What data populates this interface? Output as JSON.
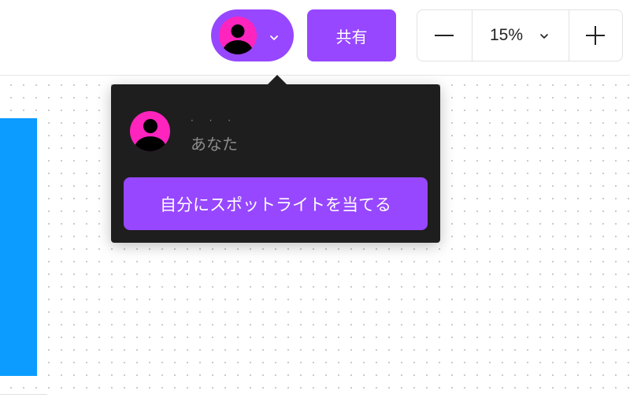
{
  "toolbar": {
    "share_label": "共有",
    "zoom_level": "15%"
  },
  "user_popover": {
    "user_name": "· · ·",
    "you_label": "あなた",
    "spotlight_label": "自分にスポットライトを当てる"
  },
  "icons": {
    "avatar": "user-avatar-icon",
    "chevron": "chevron-down-icon",
    "zoom_out": "minus-icon",
    "zoom_in": "plus-icon"
  },
  "colors": {
    "accent": "#9747ff",
    "avatar_bg": "#ff24bd",
    "popover_bg": "#1e1e1e",
    "frame_blue": "#0c9cff"
  }
}
